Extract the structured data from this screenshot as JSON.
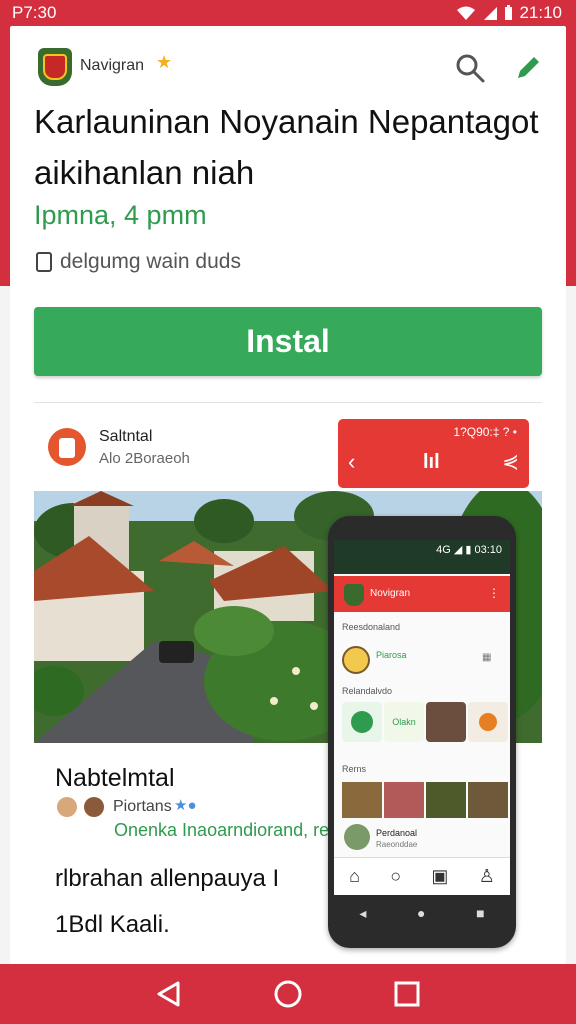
{
  "status": {
    "time": "P7:30",
    "right_time": "21:10"
  },
  "app": {
    "brand_name": "Navigran"
  },
  "header": {
    "title": "Karlauninan Noyanain Nepantagot aikihanlan niah",
    "subtitle": "Ipmna, 4 pmm",
    "checkbox_label": "delgumg wain duds"
  },
  "actions": {
    "install_label": "Instal"
  },
  "publisher": {
    "name": "Saltntal",
    "meta": "Alo 2Boraeoh"
  },
  "mini_bar": {
    "status": "1?Q90:‡ ? •",
    "center": "lıl"
  },
  "post": {
    "title": "Nabtelmtal",
    "author": "Piortans",
    "link": "Onenka Inaoarndiorand, re",
    "body": "rlbrahan allenpauya I 1Bdl Kaali."
  },
  "phone": {
    "status": "4G ◢ ▮ 03:10",
    "app_title": "Novigran",
    "section1": "Reesdonaland",
    "user1": "Piarosa",
    "section2": "Relandalvdo",
    "tile_label": "Olakn",
    "section3": "Rerns",
    "user2": "Perdanoal",
    "user2_sub": "Raeonddae"
  },
  "colors": {
    "accent_red": "#d32f3f",
    "install_green": "#37a95a",
    "link_green": "#2e9b4e"
  }
}
